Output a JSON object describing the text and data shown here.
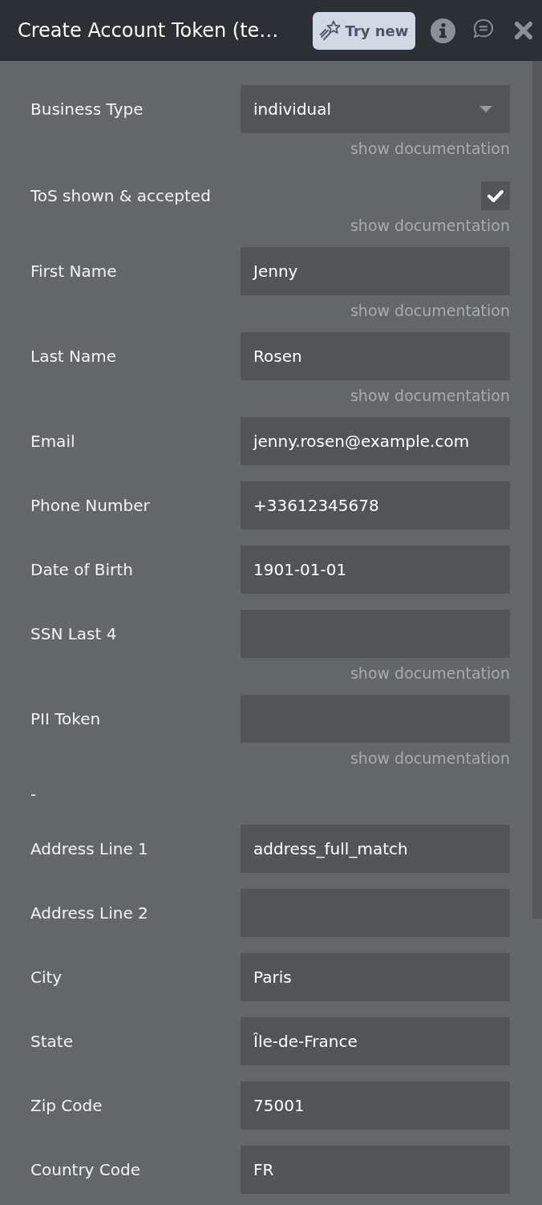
{
  "header": {
    "title": "Create Account Token (te…",
    "try_new_button": "Try new"
  },
  "params": [
    {
      "kind": "dropdown",
      "label": "Business Type",
      "value": "individual",
      "doc_link": "show documentation"
    },
    {
      "kind": "checkbox",
      "label": "ToS shown & accepted",
      "checked": true,
      "doc_link": "show documentation"
    },
    {
      "kind": "text",
      "label": "First Name",
      "value": "Jenny",
      "doc_link": "show documentation"
    },
    {
      "kind": "text",
      "label": "Last Name",
      "value": "Rosen",
      "doc_link": "show documentation"
    },
    {
      "kind": "text",
      "label": "Email",
      "value": "jenny.rosen@example.com"
    },
    {
      "kind": "text",
      "label": "Phone Number",
      "value": "+33612345678"
    },
    {
      "kind": "text",
      "label": "Date of Birth",
      "value": "1901-01-01"
    },
    {
      "kind": "text",
      "label": "SSN Last 4",
      "doc_link": "show documentation"
    },
    {
      "kind": "text",
      "label": "PII Token",
      "doc_link": "show documentation"
    },
    {
      "kind": "separator",
      "label": "-"
    },
    {
      "kind": "text",
      "label": "Address Line 1",
      "value": "address_full_match"
    },
    {
      "kind": "text",
      "label": "Address Line 2"
    },
    {
      "kind": "text",
      "label": "City",
      "value": "Paris"
    },
    {
      "kind": "text",
      "label": "State",
      "value": "Île-de-France"
    },
    {
      "kind": "text",
      "label": "Zip Code",
      "value": "75001"
    },
    {
      "kind": "text",
      "label": "Country Code",
      "value": "FR"
    }
  ]
}
